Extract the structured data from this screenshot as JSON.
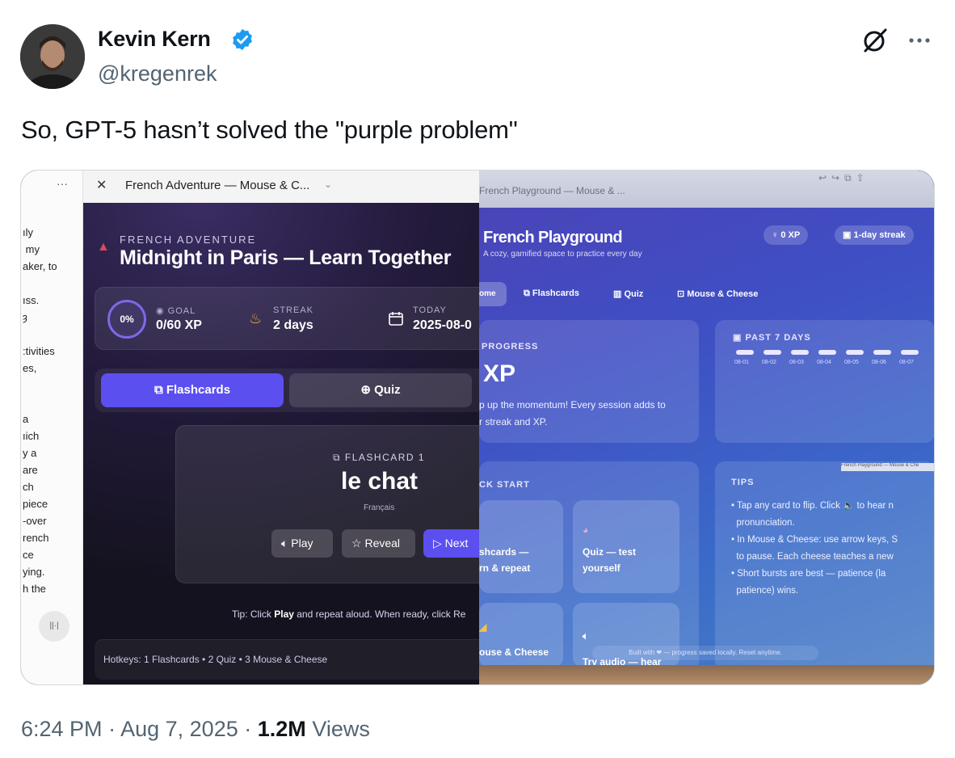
{
  "tweet": {
    "author_name": "Kevin Kern",
    "handle": "@kregenrek",
    "text": "So, GPT-5 hasn’t solved the \"purple problem\"",
    "time": "6:24 PM",
    "date": "Aug 7, 2025",
    "views_count": "1.2M",
    "views_label": "Views",
    "separator": "·",
    "verified_color": "#1d9bf0"
  },
  "left_app": {
    "window_title": "French Adventure — Mouse & C...",
    "more_dots": "···",
    "chat_text": "ıly\n my\naker, to\n\nıss.\nȝ\n\n:tivities\nes,\n\n\na\nıich\ny a\nare\nch\npiece\n-over\nrench\nce\nying.\nh the",
    "kicker": "FRENCH ADVENTURE",
    "title": "Midnight in Paris — Learn Together",
    "progress_ring": "0%",
    "goal_label": "GOAL",
    "goal_value": "0/60 XP",
    "streak_label": "STREAK",
    "streak_value": "2 days",
    "today_label": "TODAY",
    "today_value": "2025-08-0",
    "tab_flashcards": "Flashcards",
    "tab_quiz": "Quiz",
    "card_label": "FLASHCARD 1",
    "card_word": "le chat",
    "card_lang": "Français",
    "btn_play": "Play",
    "btn_reveal": "Reveal",
    "btn_next": "Next",
    "tip_prefix": "Tip: Click ",
    "tip_bold": "Play",
    "tip_suffix": " and repeat aloud. When ready, click Re",
    "hotkeys": "Hotkeys: 1 Flashcards • 2 Quiz • 3 Mouse & Cheese",
    "accent_color": "#5b4ff0"
  },
  "right_app": {
    "tab_title": "French Playground — Mouse & ...",
    "title": "French Playground",
    "subtitle": "A cozy, gamified space to practice every day",
    "xp_chip": "0 XP",
    "streak_chip": "1-day streak",
    "nav_home": "ome",
    "nav_flashcards": "Flashcards",
    "nav_quiz": "Quiz",
    "nav_mouse": "Mouse & Cheese",
    "progress_kicker": "PROGRESS",
    "progress_value": "XP",
    "progress_line1": "p up the momentum! Every session adds to",
    "progress_line2": "r streak and XP.",
    "past_kicker": "PAST 7 DAYS",
    "days": [
      "08-01",
      "08-02",
      "08-03",
      "08-04",
      "08-05",
      "08-06",
      "08-07"
    ],
    "quick_kicker": "CK START",
    "qs_flash_1": "shcards —",
    "qs_flash_2": "rn & repeat",
    "qs_quiz_1": "Quiz — test",
    "qs_quiz_2": "yourself",
    "qs_mouse": "ouse & Cheese",
    "qs_audio": "Try audio — hear",
    "tips_kicker": "TIPS",
    "tip1_a": "• Tap any card to flip. Click 🔈 to hear n",
    "tip1_b": "pronunciation.",
    "tip2_a": "• In Mouse & Cheese: use arrow keys, S",
    "tip2_b": "to pause. Each cheese teaches a new",
    "tip3_a": "• Short bursts are best — patience (la",
    "tip3_b": "patience) wins.",
    "footer": "Built with ❤ — progress saved locally. Reset anytime.",
    "tooltip": "French Playground — Mouse & Che"
  }
}
